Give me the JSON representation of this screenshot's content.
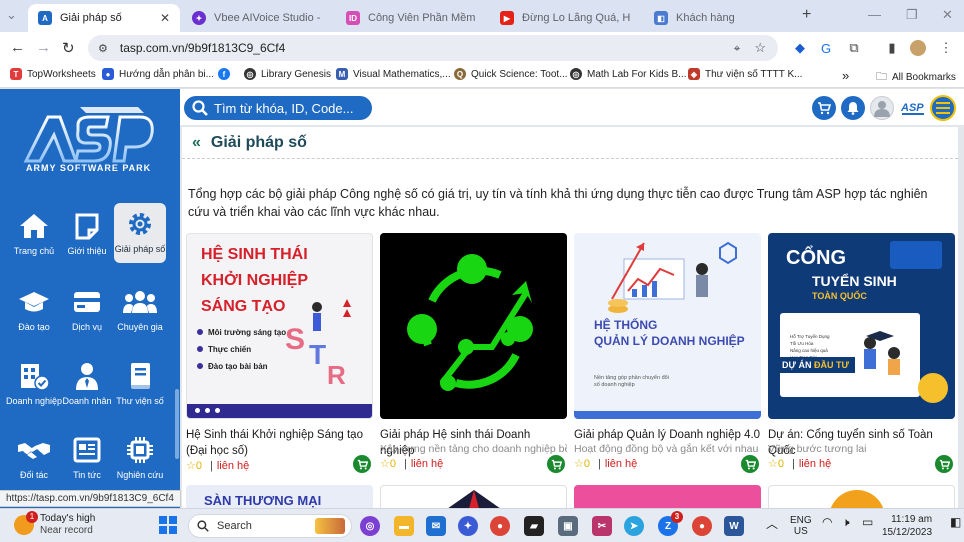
{
  "browser": {
    "tabs": [
      {
        "title": "Giải pháp số",
        "active": true,
        "favicon_color": "#1f6ac2"
      },
      {
        "title": "Vbee AIVoice Studio - Cô",
        "active": false,
        "favicon_color": "#6b2fd1"
      },
      {
        "title": "Công Viên Phần Mềm Q",
        "active": false,
        "favicon_color": "#d64fb7"
      },
      {
        "title": "Đừng Lo Lắng Quá, Hãy",
        "active": false,
        "favicon_color": "#e62117"
      },
      {
        "title": "Khách hàng",
        "active": false,
        "favicon_color": "#4a7bd0"
      }
    ],
    "url": "tasp.com.vn/9b9f1813C9_6Cf4",
    "bookmarks": [
      {
        "label": "TopWorksheets",
        "color": "#e23b3b"
      },
      {
        "label": "Hướng dẫn phân bi...",
        "color": "#2a5bd7"
      },
      {
        "label": "",
        "color": "#1877f2"
      },
      {
        "label": "Library Genesis",
        "color": "#333333"
      },
      {
        "label": "Visual Mathematics,...",
        "color": "#3a5fb0"
      },
      {
        "label": "Quick Science: Toot...",
        "color": "#8a6a3a"
      },
      {
        "label": "Math Lab For Kids B...",
        "color": "#333333"
      },
      {
        "label": "Thư viện số TTTT K...",
        "color": "#c0392b"
      }
    ],
    "all_bookmarks": "All Bookmarks",
    "overflow": "»"
  },
  "sidebar": {
    "brand": "ARMY SOFTWARE PARK",
    "items": [
      {
        "label": "Trang chủ",
        "icon": "home-icon"
      },
      {
        "label": "Giới thiệu",
        "icon": "note-icon"
      },
      {
        "label": "Giải pháp số",
        "icon": "gear-icon",
        "active": true
      },
      {
        "label": "Đào tạo",
        "icon": "graduation-cap-icon"
      },
      {
        "label": "Dịch vụ",
        "icon": "card-icon"
      },
      {
        "label": "Chuyên gia",
        "icon": "users-icon"
      },
      {
        "label": "Doanh nghiệp",
        "icon": "building-icon"
      },
      {
        "label": "Doanh nhân",
        "icon": "person-icon"
      },
      {
        "label": "Thư viện số",
        "icon": "book-icon"
      },
      {
        "label": "Đối tác",
        "icon": "handshake-icon"
      },
      {
        "label": "Tin tức",
        "icon": "news-icon"
      },
      {
        "label": "Nghiên cứu",
        "icon": "chip-icon"
      }
    ]
  },
  "search": {
    "placeholder": "Tìm từ khóa, ID, Code..."
  },
  "page": {
    "title": "Giải pháp số",
    "intro": "Tổng hợp các bộ giải pháp Công nghệ số có giá trị, uy tín và tính khả thi ứng dụng thực tiễn cao được Trung tâm ASP hợp tác nghiên cứu và triển khai vào các lĩnh vực khác nhau."
  },
  "cards": [
    {
      "name": "Hệ Sinh thái Khởi nghiệp Sáng tạo (Đại học số)",
      "subtitle": "",
      "rating": "0",
      "contact": "liên hệ",
      "image": {
        "heading1": "HỆ SINH THÁI",
        "heading2": "KHỞI NGHIỆP",
        "heading3": "SÁNG TẠO",
        "bullets": [
          "Môi trường sáng tạo",
          "Thực chiến",
          "Đào tạo bài bản"
        ]
      }
    },
    {
      "name": "Giải pháp Hệ sinh thái Doanh nghiệp",
      "subtitle": "Xây dựng nền tảng cho doanh nghiệp bền",
      "rating": "0",
      "contact": "liên hệ"
    },
    {
      "name": "Giải pháp Quản lý Doanh nghiệp 4.0",
      "subtitle": "Hoạt động đồng bộ và gắn kết với nhau",
      "rating": "0",
      "contact": "liên hệ",
      "image": {
        "heading1": "HỆ THỐNG",
        "heading2": "QUẢN LÝ DOANH NGHIỆP",
        "caption": "Nền tảng góp phần chuyển đổi số doanh nghiệp"
      }
    },
    {
      "name": "Dự án: Cổng tuyển sinh số Toàn Quốc",
      "subtitle": "Vững bước tương lai",
      "rating": "0",
      "contact": "liên hệ",
      "image": {
        "heading1": "CỔNG",
        "heading2": "TUYỂN SINH",
        "heading3": "TOÀN QUỐC",
        "badge": "DỰ ÁN",
        "badge2": "ĐẦU TƯ",
        "list": [
          "Hỗ Trợ Tuyển Dụng",
          "Tối Ưu Hóa",
          "Nâng cao hiệu quả",
          "Học Trọn Đời"
        ]
      }
    }
  ],
  "next_row": {
    "card1_text": "SÀN THƯƠNG MẠI"
  },
  "status_url": "https://tasp.com.vn/9b9f1813C9_6Cf4",
  "taskbar": {
    "weather_title": "Today's high",
    "weather_sub": "Near record",
    "search_placeholder": "Search",
    "lang1": "ENG",
    "lang2": "US",
    "time": "11:19 am",
    "date": "15/12/2023",
    "zalo_badge": "3",
    "weather_badge": "1"
  },
  "colors": {
    "sidebar": "#1f6ac2",
    "accent": "#1f6ac2",
    "cart_green": "#1b8a2f",
    "contact_red": "#d21c1c"
  }
}
